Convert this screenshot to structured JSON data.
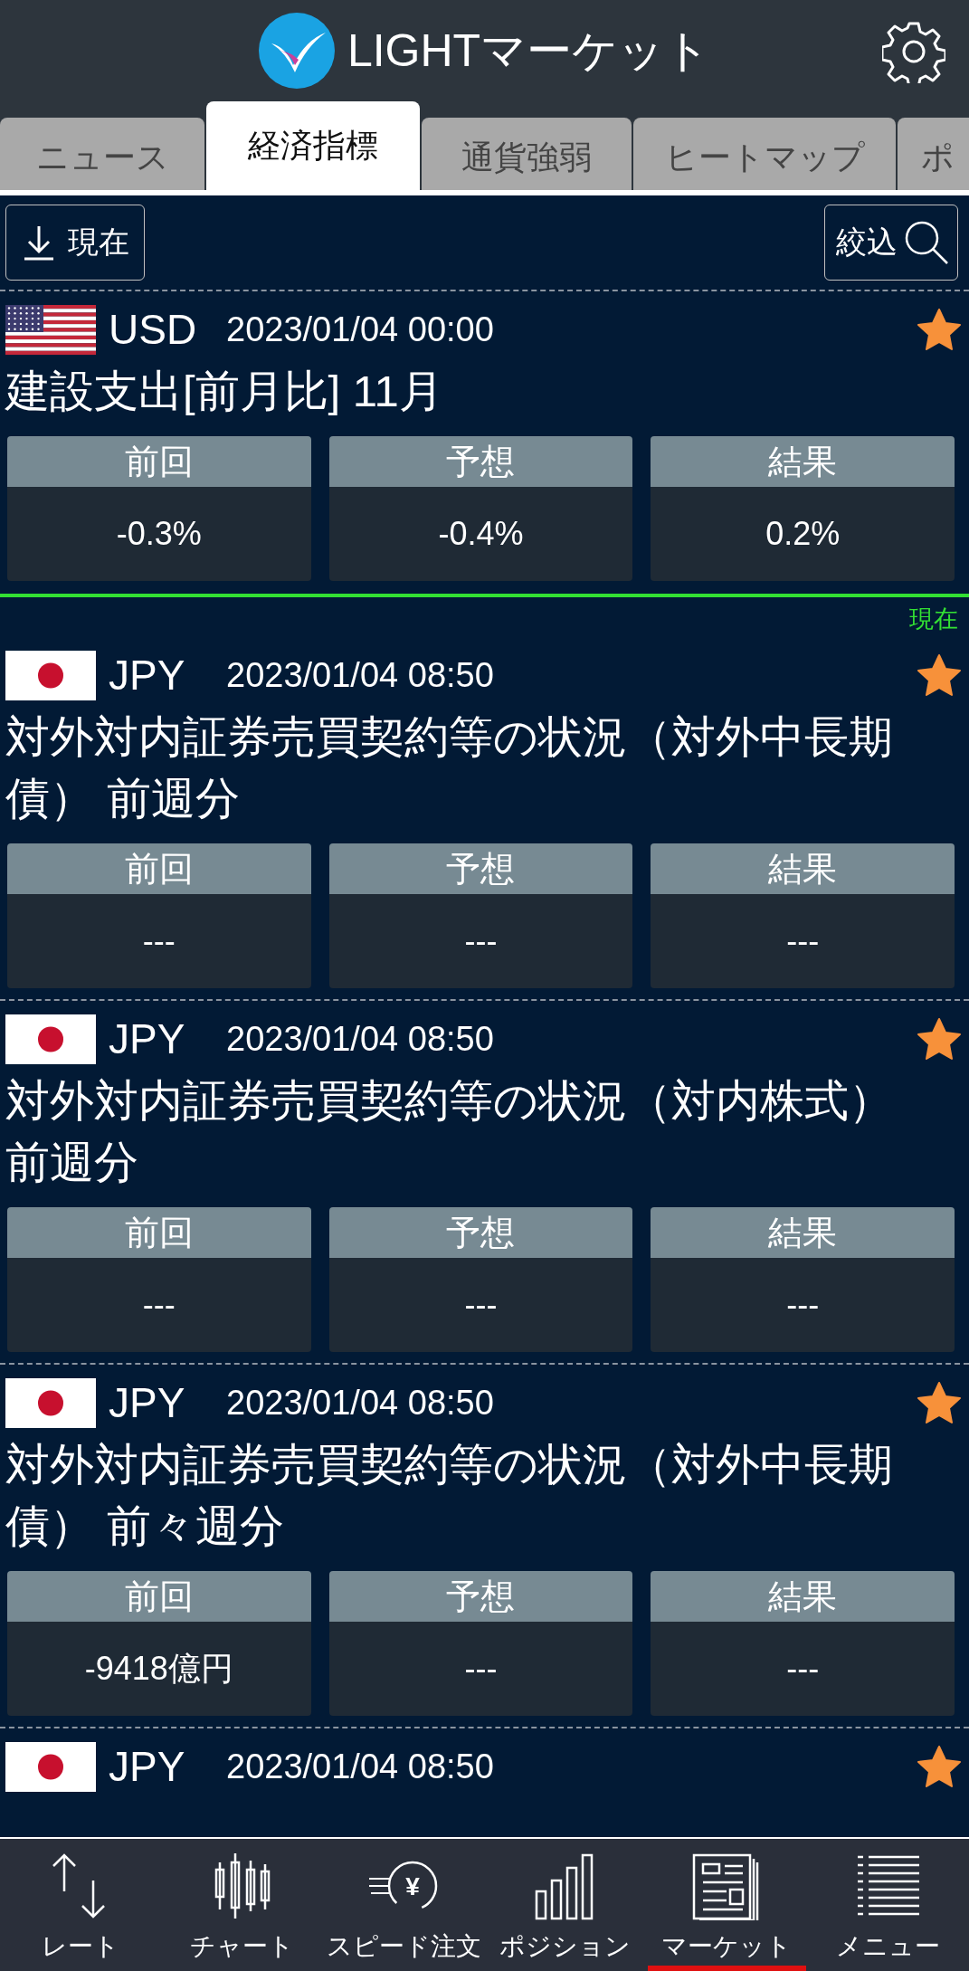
{
  "header": {
    "title": "LIGHTマーケット"
  },
  "tabs": [
    {
      "label": "ニュース",
      "selected": false
    },
    {
      "label": "経済指標",
      "selected": true
    },
    {
      "label": "通貨強弱",
      "selected": false
    },
    {
      "label": "ヒートマップ",
      "selected": false
    },
    {
      "label": "ポ",
      "selected": false
    }
  ],
  "toolbar": {
    "now_button": "現在",
    "filter_button": "絞込"
  },
  "timeline": [
    {
      "kind": "us",
      "currency": "USD",
      "datetime": "2023/01/04 00:00",
      "favorite": true,
      "title": "建設支出[前月比] 11月",
      "cells": [
        {
          "label": "前回",
          "value": "-0.3%"
        },
        {
          "label": "予想",
          "value": "-0.4%"
        },
        {
          "label": "結果",
          "value": "0.2%"
        }
      ]
    },
    {
      "kind": "now",
      "label": "現在"
    },
    {
      "kind": "jp",
      "currency": "JPY",
      "datetime": "2023/01/04 08:50",
      "favorite": true,
      "title": "対外対内証券売買契約等の状況（対外中長期債） 前週分",
      "cells": [
        {
          "label": "前回",
          "value": "---"
        },
        {
          "label": "予想",
          "value": "---"
        },
        {
          "label": "結果",
          "value": "---"
        }
      ]
    },
    {
      "kind": "jp",
      "currency": "JPY",
      "datetime": "2023/01/04 08:50",
      "favorite": true,
      "title": "対外対内証券売買契約等の状況（対内株式）前週分",
      "cells": [
        {
          "label": "前回",
          "value": "---"
        },
        {
          "label": "予想",
          "value": "---"
        },
        {
          "label": "結果",
          "value": "---"
        }
      ]
    },
    {
      "kind": "jp",
      "currency": "JPY",
      "datetime": "2023/01/04 08:50",
      "favorite": true,
      "title": "対外対内証券売買契約等の状況（対外中長期債） 前々週分",
      "cells": [
        {
          "label": "前回",
          "value": "-9418億円"
        },
        {
          "label": "予想",
          "value": "---"
        },
        {
          "label": "結果",
          "value": "---"
        }
      ]
    },
    {
      "kind": "jp",
      "currency": "JPY",
      "datetime": "2023/01/04 08:50",
      "favorite": true
    }
  ],
  "nav": [
    {
      "label": "レート",
      "selected": false
    },
    {
      "label": "チャート",
      "selected": false
    },
    {
      "glyph": "¥",
      "label": "スピード注文",
      "selected": false
    },
    {
      "label": "ポジション",
      "selected": false
    },
    {
      "label": "マーケット",
      "selected": true
    },
    {
      "label": "メニュー",
      "selected": false
    }
  ]
}
